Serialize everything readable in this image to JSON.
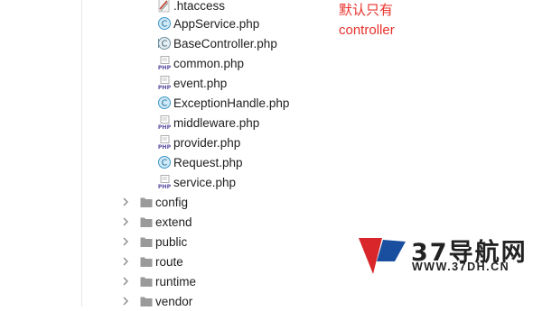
{
  "tree": {
    "files": [
      {
        "name": ".htaccess",
        "icon": "htaccess-file-icon"
      },
      {
        "name": "AppService.php",
        "icon": "php-class-icon"
      },
      {
        "name": "BaseController.php",
        "icon": "php-abstract-class-icon"
      },
      {
        "name": "common.php",
        "icon": "php-file-icon"
      },
      {
        "name": "event.php",
        "icon": "php-file-icon"
      },
      {
        "name": "ExceptionHandle.php",
        "icon": "php-class-icon"
      },
      {
        "name": "middleware.php",
        "icon": "php-file-icon"
      },
      {
        "name": "provider.php",
        "icon": "php-file-icon"
      },
      {
        "name": "Request.php",
        "icon": "php-class-icon"
      },
      {
        "name": "service.php",
        "icon": "php-file-icon"
      }
    ],
    "folders": [
      {
        "name": "config"
      },
      {
        "name": "extend"
      },
      {
        "name": "public"
      },
      {
        "name": "route"
      },
      {
        "name": "runtime"
      },
      {
        "name": "vendor"
      }
    ]
  },
  "annotation": {
    "line1": "默认只有",
    "line2": "controller",
    "color": "#e8322b"
  },
  "watermark": {
    "title": "37导航网",
    "url": "WWW.37DH.CN",
    "brand_colors": [
      "#d8262a",
      "#1a4fa0"
    ]
  }
}
